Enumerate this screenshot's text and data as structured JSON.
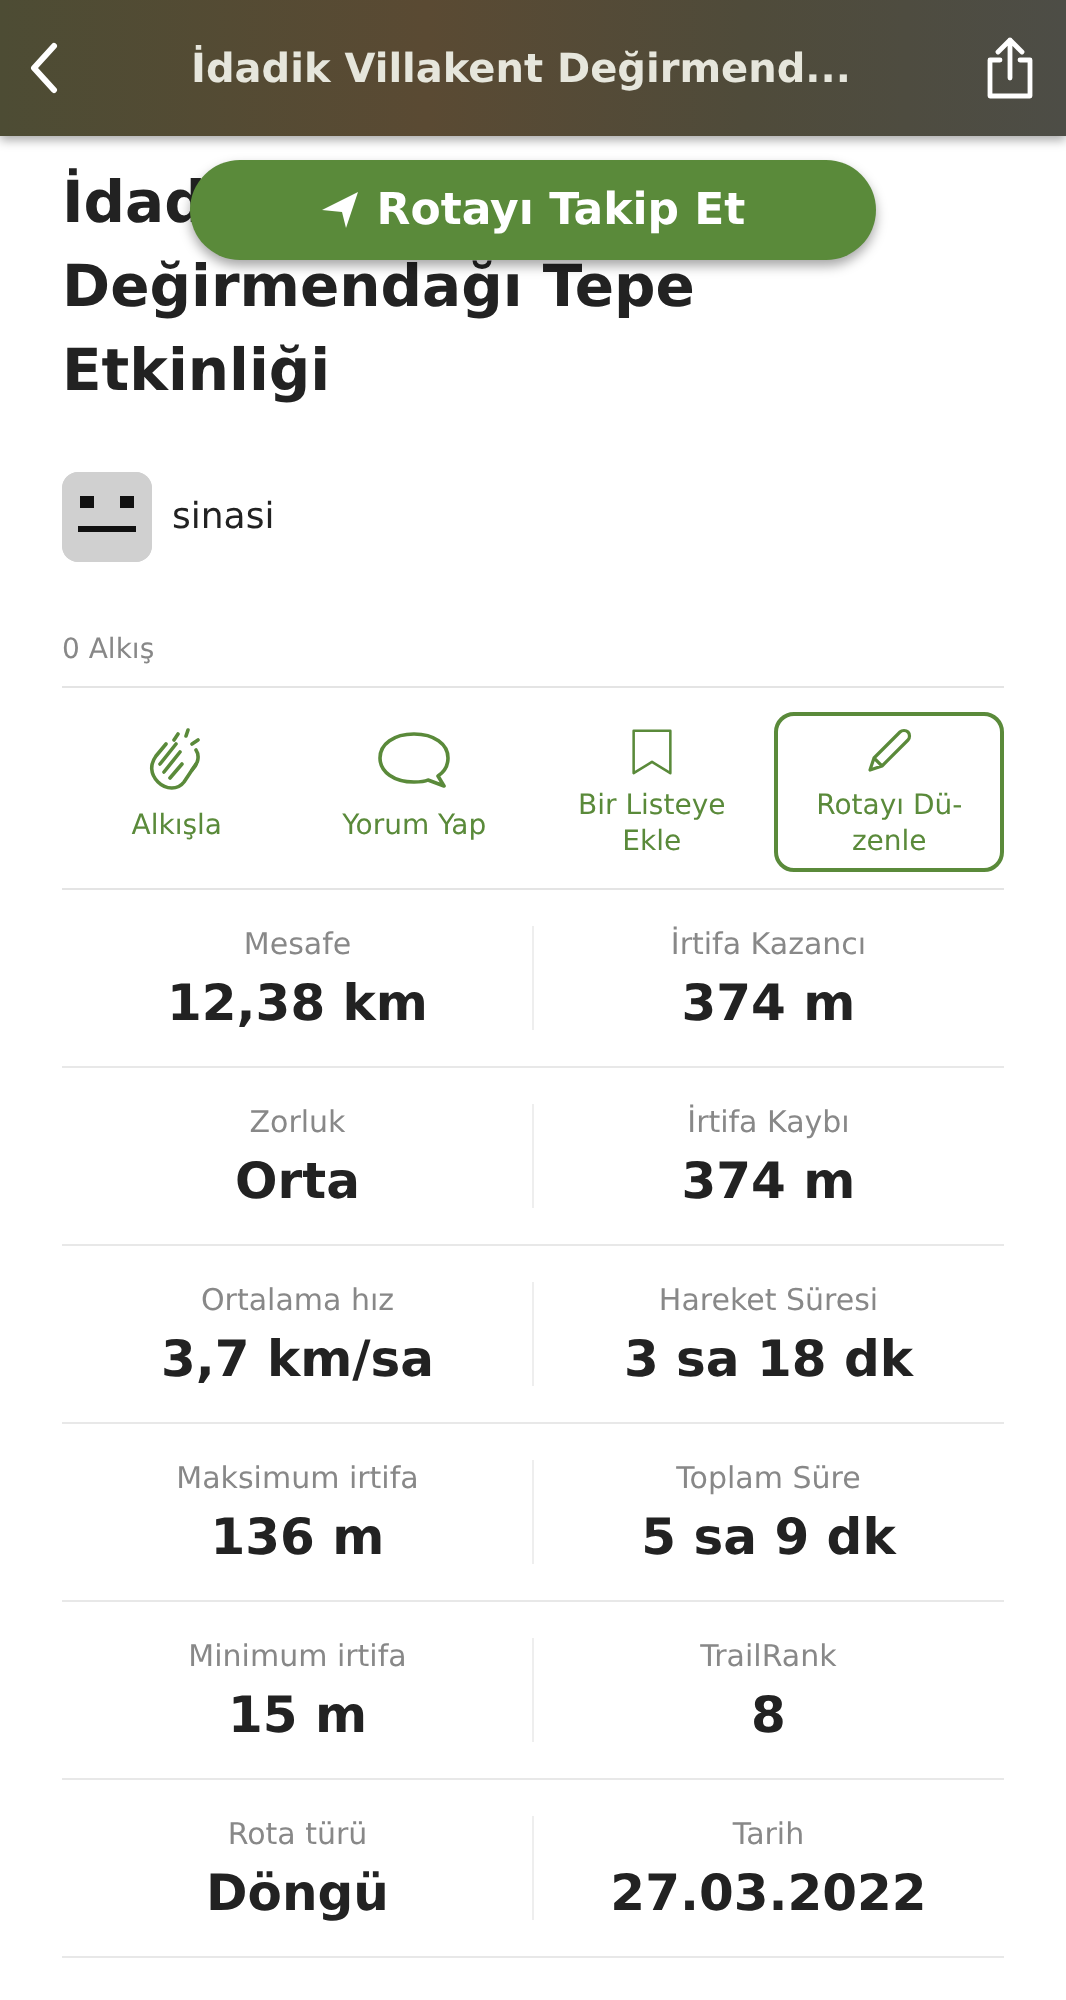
{
  "header": {
    "title": "İdadik Villakent Değirmend..."
  },
  "follow_button": {
    "label": "Rotayı Takip Et"
  },
  "title": {
    "visible_start": "İdad",
    "rest": "Değirmendağı Tepe Etkinliği"
  },
  "author": {
    "name": "sinasi"
  },
  "claps": "0 Alkış",
  "actions": [
    {
      "label": "Alkışla",
      "kind": "plain"
    },
    {
      "label": "Yorum Yap",
      "kind": "plain"
    },
    {
      "label": "Bir Listeye Ekle",
      "kind": "plain"
    },
    {
      "label": "Rotayı Dü-zenle",
      "kind": "outlined"
    }
  ],
  "stats": [
    {
      "label": "Mesafe",
      "value": "12,38 km"
    },
    {
      "label": "İrtifa Kazancı",
      "value": "374 m"
    },
    {
      "label": "Zorluk",
      "value": "Orta"
    },
    {
      "label": "İrtifa Kaybı",
      "value": "374 m"
    },
    {
      "label": "Ortalama hız",
      "value": "3,7 km/sa"
    },
    {
      "label": "Hareket Süresi",
      "value": "3 sa 18 dk"
    },
    {
      "label": "Maksimum irtifa",
      "value": "136 m"
    },
    {
      "label": "Toplam Süre",
      "value": "5 sa 9 dk"
    },
    {
      "label": "Minimum irtifa",
      "value": "15 m"
    },
    {
      "label": "TrailRank",
      "value": "8"
    },
    {
      "label": "Rota türü",
      "value": "Döngü"
    },
    {
      "label": "Tarih",
      "value": "27.03.2022"
    }
  ]
}
